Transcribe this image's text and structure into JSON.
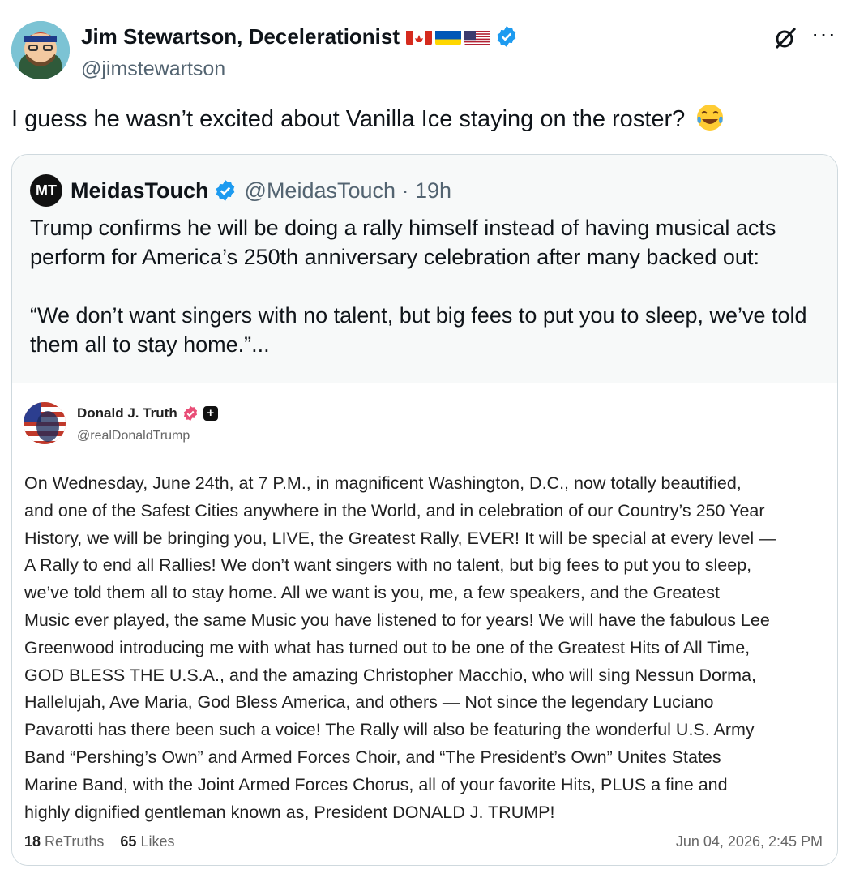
{
  "author": {
    "display_name": "Jim Stewartson, Decelerationist",
    "handle": "@jimstewartson",
    "verified_icon": "verified-badge-icon",
    "flags": [
      "canada-flag-icon",
      "ukraine-flag-icon",
      "usa-flag-icon"
    ]
  },
  "tweet_text": "I guess he wasn’t excited about Vanilla Ice staying on the roster?",
  "quoted": {
    "logo_text": "MT",
    "name": "MeidasTouch",
    "handle_time": "@MeidasTouch · 19h",
    "paragraphs": [
      "Trump confirms he will be doing a rally himself instead of having musical acts perform for America’s 250th anniversary celebration after many backed out:",
      "“We don’t want singers with no talent, but big fees to put you to sleep, we’ve told them all to stay home.”..."
    ]
  },
  "truth_post": {
    "name": "Donald J. Truth",
    "handle": "@realDonaldTrump",
    "lines": [
      "On Wednesday, June 24th, at 7 P.M., in magnificent Washington, D.C., now totally beautified,",
      "and one of the Safest Cities anywhere in the World, and in celebration of our Country’s 250 Year",
      "History, we will be bringing you, LIVE, the Greatest Rally, EVER! It will be special at every level —",
      "A Rally to end all Rallies! We don’t want singers with no talent, but big fees to put you to sleep,",
      "we’ve told them all to stay home. All we want is you, me, a few speakers, and the Greatest",
      "Music ever played, the same Music you have listened to for years! We will have the fabulous Lee",
      "Greenwood introducing me with what has turned out to be one of the Greatest Hits of All Time,",
      "GOD BLESS THE U.S.A., and the amazing Christopher Macchio, who will sing Nessun Dorma,",
      "Hallelujah, Ave Maria, God Bless America, and others — Not since the legendary Luciano",
      "Pavarotti has there been such a voice! The Rally will also be featuring the wonderful U.S. Army",
      "Band “Pershing’s Own” and Armed Forces Choir, and “The President’s Own” Unites States",
      "Marine Band, with the Joint Armed Forces Chorus, all of your favorite Hits, PLUS a fine and",
      "highly dignified gentleman known as, President DONALD J. TRUMP!"
    ],
    "retruths_count": "18",
    "retruths_label": "ReTruths",
    "likes_count": "65",
    "likes_label": "Likes",
    "timestamp": "Jun 04, 2026, 2:45 PM"
  },
  "colors": {
    "verified_blue": "#1d9bf0",
    "secondary_text": "#536471",
    "quote_bg": "#f7f9f9",
    "border": "#cfd9de"
  }
}
